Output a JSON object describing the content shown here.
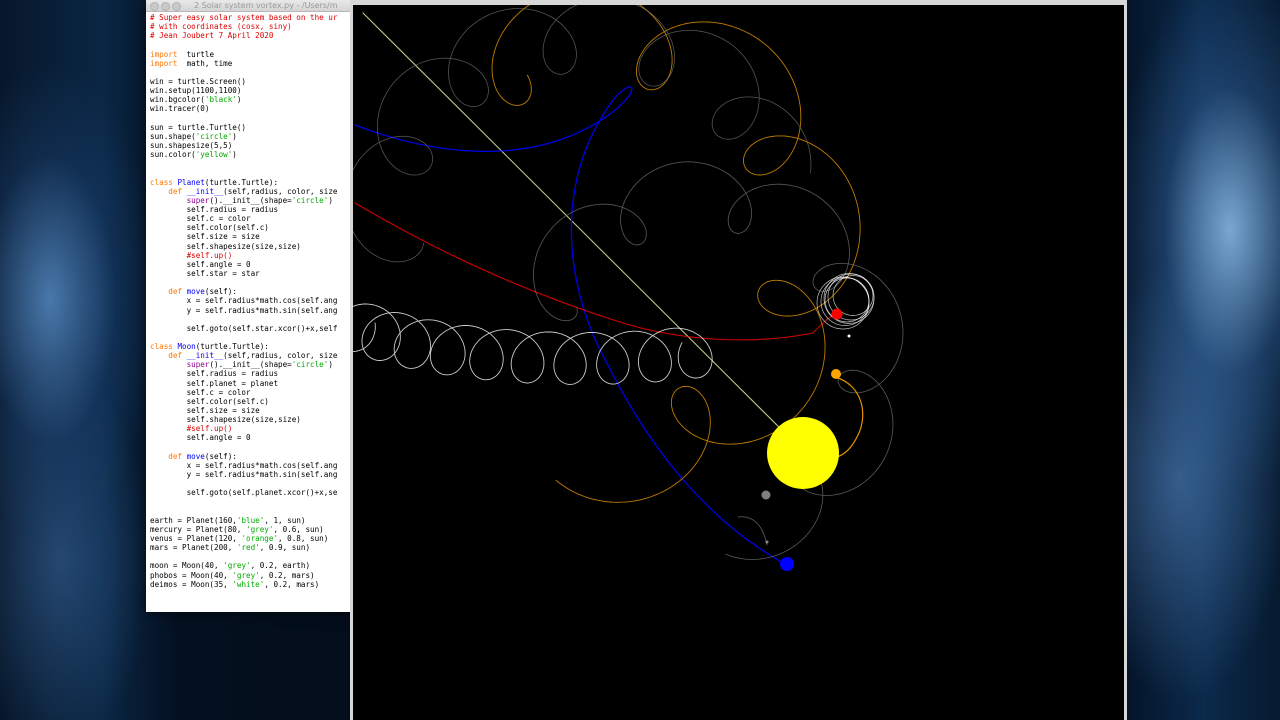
{
  "editor": {
    "title": "2 Solar system vortex.py - /Users/m",
    "lines": [
      [
        [
          "cm",
          "# Super easy solar system based on the ur"
        ]
      ],
      [
        [
          "cm",
          "# with coordinates (cosx, siny)"
        ]
      ],
      [
        [
          "cm",
          "# Jean Joubert 7 April 2020"
        ]
      ],
      [],
      [
        [
          "kw",
          "import"
        ],
        [
          "",
          "  turtle"
        ]
      ],
      [
        [
          "kw",
          "import"
        ],
        [
          "",
          "  math, time"
        ]
      ],
      [],
      [
        [
          "",
          "win = turtle.Screen()"
        ]
      ],
      [
        [
          "",
          "win.setup(1100,1100)"
        ]
      ],
      [
        [
          "",
          "win.bgcolor("
        ],
        [
          "str",
          "'black'"
        ],
        [
          "",
          ")"
        ]
      ],
      [
        [
          "",
          "win.tracer(0)"
        ]
      ],
      [],
      [
        [
          "",
          "sun = turtle.Turtle()"
        ]
      ],
      [
        [
          "",
          "sun.shape("
        ],
        [
          "str",
          "'circle'"
        ],
        [
          "",
          ")"
        ]
      ],
      [
        [
          "",
          "sun.shapesize(5,5)"
        ]
      ],
      [
        [
          "",
          "sun.color("
        ],
        [
          "str",
          "'yellow'"
        ],
        [
          "",
          ")"
        ]
      ],
      [],
      [],
      [
        [
          "kw",
          "class"
        ],
        [
          "",
          " "
        ],
        [
          "fn",
          "Planet"
        ],
        [
          "",
          "(turtle.Turtle):"
        ]
      ],
      [
        [
          "",
          "    "
        ],
        [
          "kw",
          "def"
        ],
        [
          "",
          " "
        ],
        [
          "fn",
          "__init__"
        ],
        [
          "",
          "(self,radius, color, size"
        ]
      ],
      [
        [
          "",
          "        "
        ],
        [
          "bi",
          "super"
        ],
        [
          "",
          "().__init__(shape="
        ],
        [
          "str",
          "'circle'"
        ],
        [
          "",
          ")"
        ]
      ],
      [
        [
          "",
          "        self.radius = radius"
        ]
      ],
      [
        [
          "",
          "        self.c = color"
        ]
      ],
      [
        [
          "",
          "        self.color(self.c)"
        ]
      ],
      [
        [
          "",
          "        self.size = size"
        ]
      ],
      [
        [
          "",
          "        self.shapesize(size,size)"
        ]
      ],
      [
        [
          "",
          "        "
        ],
        [
          "cm",
          "#self.up()"
        ]
      ],
      [
        [
          "",
          "        self.angle = 0"
        ]
      ],
      [
        [
          "",
          "        self.star = star"
        ]
      ],
      [],
      [
        [
          "",
          "    "
        ],
        [
          "kw",
          "def"
        ],
        [
          "",
          " "
        ],
        [
          "fn",
          "move"
        ],
        [
          "",
          "(self):"
        ]
      ],
      [
        [
          "",
          "        x = self.radius*math.cos(self.ang"
        ]
      ],
      [
        [
          "",
          "        y = self.radius*math.sin(self.ang"
        ]
      ],
      [],
      [
        [
          "",
          "        self.goto(self.star.xcor()+x,self"
        ]
      ],
      [],
      [
        [
          "kw",
          "class"
        ],
        [
          "",
          " "
        ],
        [
          "fn",
          "Moon"
        ],
        [
          "",
          "(turtle.Turtle):"
        ]
      ],
      [
        [
          "",
          "    "
        ],
        [
          "kw",
          "def"
        ],
        [
          "",
          " "
        ],
        [
          "fn",
          "__init__"
        ],
        [
          "",
          "(self,radius, color, size"
        ]
      ],
      [
        [
          "",
          "        "
        ],
        [
          "bi",
          "super"
        ],
        [
          "",
          "().__init__(shape="
        ],
        [
          "str",
          "'circle'"
        ],
        [
          "",
          ")"
        ]
      ],
      [
        [
          "",
          "        self.radius = radius"
        ]
      ],
      [
        [
          "",
          "        self.planet = planet"
        ]
      ],
      [
        [
          "",
          "        self.c = color"
        ]
      ],
      [
        [
          "",
          "        self.color(self.c)"
        ]
      ],
      [
        [
          "",
          "        self.size = size"
        ]
      ],
      [
        [
          "",
          "        self.shapesize(size,size)"
        ]
      ],
      [
        [
          "",
          "        "
        ],
        [
          "cm",
          "#self.up()"
        ]
      ],
      [
        [
          "",
          "        self.angle = 0"
        ]
      ],
      [],
      [
        [
          "",
          "    "
        ],
        [
          "kw",
          "def"
        ],
        [
          "",
          " "
        ],
        [
          "fn",
          "move"
        ],
        [
          "",
          "(self):"
        ]
      ],
      [
        [
          "",
          "        x = self.radius*math.cos(self.ang"
        ]
      ],
      [
        [
          "",
          "        y = self.radius*math.sin(self.ang"
        ]
      ],
      [],
      [
        [
          "",
          "        self.goto(self.planet.xcor()+x,se"
        ]
      ],
      [],
      [],
      [
        [
          "",
          "earth = Planet(160,"
        ],
        [
          "str",
          "'blue'"
        ],
        [
          "",
          ", 1, sun)"
        ]
      ],
      [
        [
          "",
          "mercury = Planet(80, "
        ],
        [
          "str",
          "'grey'"
        ],
        [
          "",
          ", 0.6, sun)"
        ]
      ],
      [
        [
          "",
          "venus = Planet(120, "
        ],
        [
          "str",
          "'orange'"
        ],
        [
          "",
          ", 0.8, sun)"
        ]
      ],
      [
        [
          "",
          "mars = Planet(200, "
        ],
        [
          "str",
          "'red'"
        ],
        [
          "",
          ", 0.9, sun)"
        ]
      ],
      [],
      [
        [
          "",
          "moon = Moon(40, "
        ],
        [
          "str",
          "'grey'"
        ],
        [
          "",
          ", 0.2, earth)"
        ]
      ],
      [
        [
          "",
          "phobos = Moon(40, "
        ],
        [
          "str",
          "'grey'"
        ],
        [
          "",
          ", 0.2, mars)"
        ]
      ],
      [
        [
          "",
          "deimos = Moon(35, "
        ],
        [
          "str",
          "'white'"
        ],
        [
          "",
          ", 0.2, mars)"
        ]
      ]
    ]
  },
  "colors": {
    "sun": "#ffff00",
    "earth": "#0000ff",
    "mercury": "#808080",
    "venus": "#ffa500",
    "mars": "#ff0000",
    "moon": "#8a8a8a",
    "phobos": "#8a8a8a",
    "deimos": "#ffffff",
    "sun_trail": "#e6e6a0",
    "canvas": "#000000"
  }
}
